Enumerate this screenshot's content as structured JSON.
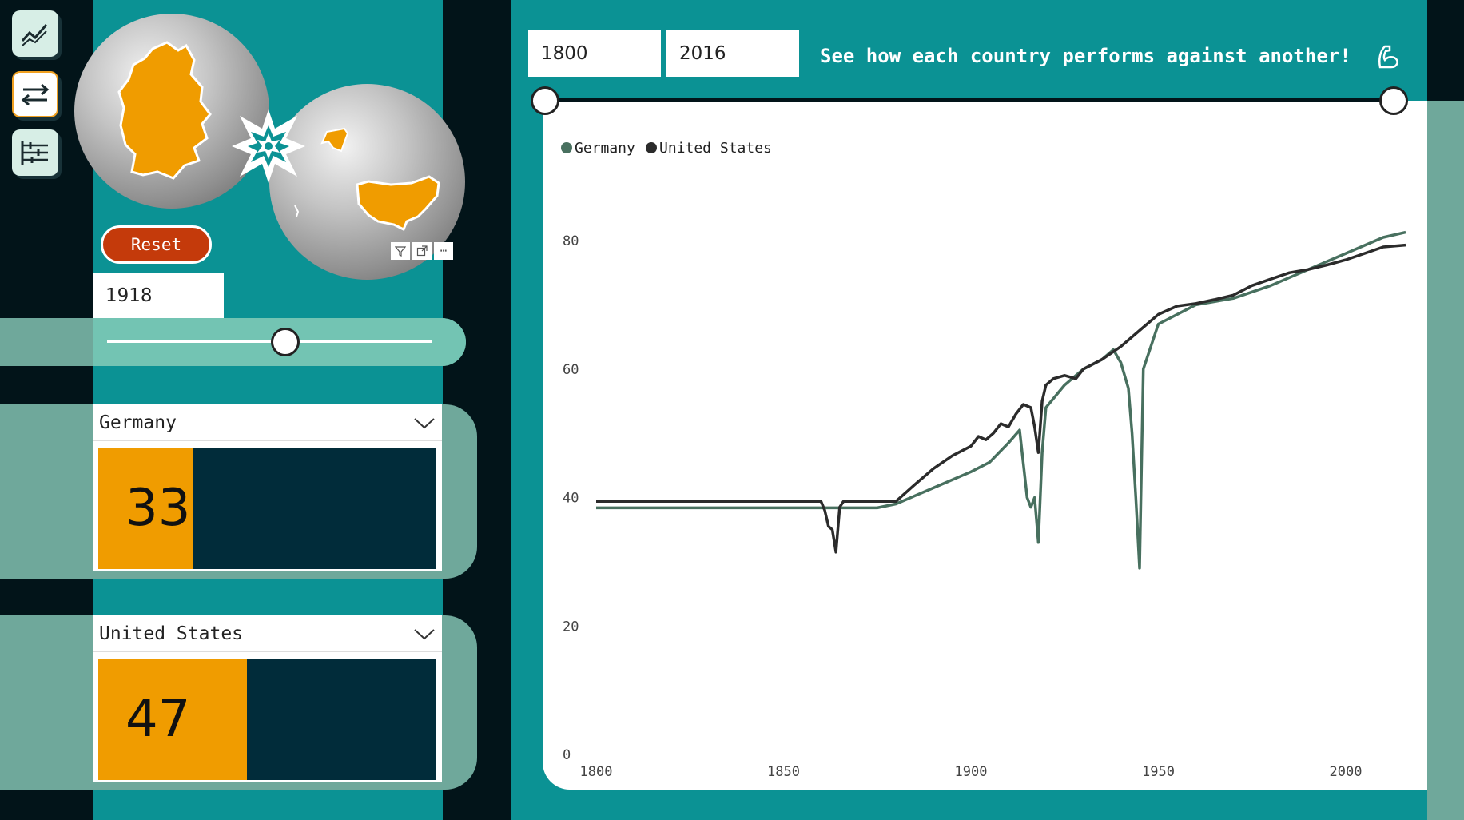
{
  "nav": {
    "items": [
      {
        "name": "trend-icon"
      },
      {
        "name": "compare-icon"
      },
      {
        "name": "filter-sliders-icon"
      }
    ]
  },
  "reset_label": "Reset",
  "selected_year": "1918",
  "year_slider_value": 1918,
  "countries": [
    {
      "name": "Germany",
      "score": "33",
      "fill_fraction": 0.28
    },
    {
      "name": "United States",
      "score": "47",
      "fill_fraction": 0.44
    }
  ],
  "range": {
    "start": "1800",
    "end": "2016"
  },
  "headline": "See how each country performs against another!",
  "colors": {
    "germany": "#48705f",
    "united_states": "#2b2b2b",
    "accent": "#f09c00",
    "teal": "#0b9294",
    "reset": "#c43a0b"
  },
  "chart_data": {
    "type": "line",
    "legend": [
      "Germany",
      "United States"
    ],
    "legend_position": "top-left",
    "xlim": [
      1800,
      2016
    ],
    "ylim": [
      0,
      80
    ],
    "x_ticks": [
      "1800",
      "1850",
      "1900",
      "1950",
      "2000"
    ],
    "y_ticks": [
      "0",
      "20",
      "40",
      "60",
      "80"
    ],
    "series": [
      {
        "name": "Germany",
        "points": [
          [
            1800,
            38.4
          ],
          [
            1875,
            38.4
          ],
          [
            1880,
            39.0
          ],
          [
            1890,
            41.5
          ],
          [
            1900,
            44.0
          ],
          [
            1905,
            45.5
          ],
          [
            1910,
            48.5
          ],
          [
            1913,
            50.5
          ],
          [
            1915,
            40.0
          ],
          [
            1916,
            38.5
          ],
          [
            1917,
            40.0
          ],
          [
            1918,
            33.0
          ],
          [
            1919,
            47.0
          ],
          [
            1920,
            54.0
          ],
          [
            1925,
            57.5
          ],
          [
            1930,
            60.0
          ],
          [
            1935,
            61.5
          ],
          [
            1938,
            63.0
          ],
          [
            1940,
            61.0
          ],
          [
            1942,
            57.0
          ],
          [
            1943,
            50.0
          ],
          [
            1944,
            40.0
          ],
          [
            1945,
            29.0
          ],
          [
            1946,
            60.0
          ],
          [
            1950,
            67.0
          ],
          [
            1960,
            70.0
          ],
          [
            1970,
            71.0
          ],
          [
            1980,
            73.0
          ],
          [
            1990,
            75.5
          ],
          [
            2000,
            78.0
          ],
          [
            2010,
            80.5
          ],
          [
            2016,
            81.3
          ]
        ]
      },
      {
        "name": "United States",
        "points": [
          [
            1800,
            39.4
          ],
          [
            1860,
            39.4
          ],
          [
            1861,
            38.0
          ],
          [
            1862,
            35.5
          ],
          [
            1863,
            35.0
          ],
          [
            1864,
            31.5
          ],
          [
            1865,
            38.5
          ],
          [
            1866,
            39.4
          ],
          [
            1880,
            39.4
          ],
          [
            1885,
            42.0
          ],
          [
            1890,
            44.5
          ],
          [
            1895,
            46.5
          ],
          [
            1900,
            48.0
          ],
          [
            1902,
            49.5
          ],
          [
            1904,
            49.0
          ],
          [
            1906,
            50.0
          ],
          [
            1908,
            51.5
          ],
          [
            1910,
            51.0
          ],
          [
            1912,
            53.0
          ],
          [
            1914,
            54.5
          ],
          [
            1916,
            54.0
          ],
          [
            1917,
            51.0
          ],
          [
            1918,
            47.0
          ],
          [
            1919,
            55.0
          ],
          [
            1920,
            57.5
          ],
          [
            1922,
            58.5
          ],
          [
            1925,
            59.0
          ],
          [
            1928,
            58.5
          ],
          [
            1930,
            60.0
          ],
          [
            1935,
            61.5
          ],
          [
            1940,
            63.5
          ],
          [
            1945,
            66.0
          ],
          [
            1950,
            68.5
          ],
          [
            1955,
            69.8
          ],
          [
            1960,
            70.2
          ],
          [
            1965,
            70.8
          ],
          [
            1970,
            71.5
          ],
          [
            1975,
            73.0
          ],
          [
            1980,
            74.0
          ],
          [
            1985,
            75.0
          ],
          [
            1990,
            75.5
          ],
          [
            1995,
            76.2
          ],
          [
            2000,
            77.0
          ],
          [
            2005,
            78.0
          ],
          [
            2010,
            79.0
          ],
          [
            2016,
            79.3
          ]
        ]
      }
    ]
  }
}
